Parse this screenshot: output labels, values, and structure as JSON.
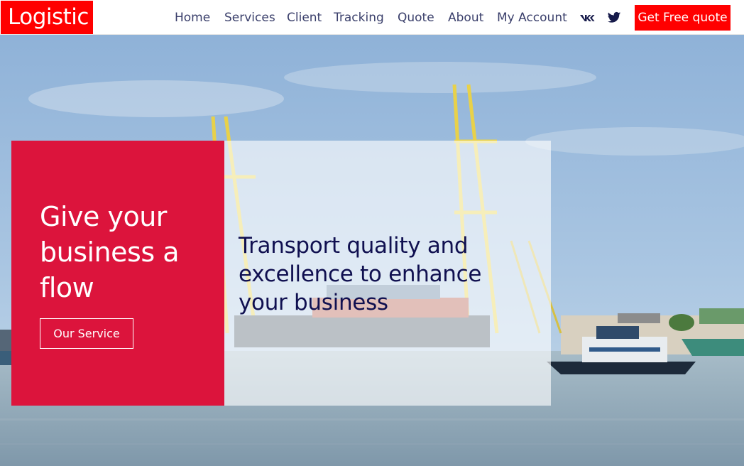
{
  "brand": {
    "logo_text": "Logistic",
    "accent_color": "#ff0000",
    "card_color": "#dc143c",
    "nav_text_color": "#3a3f6b"
  },
  "nav": {
    "items": [
      {
        "label": "Home"
      },
      {
        "label": "Services"
      },
      {
        "label": "Client"
      },
      {
        "label": "Tracking"
      },
      {
        "label": "Quote"
      },
      {
        "label": "About"
      },
      {
        "label": "My Account"
      }
    ],
    "social_icons": [
      "vk-icon",
      "twitter-icon"
    ],
    "cta_label": "Get Free quote"
  },
  "hero": {
    "background": "port-with-cranes-and-ships",
    "red_card": {
      "title": "Give your business a flow",
      "button_label": "Our Service"
    },
    "white_card": {
      "text": "Transport quality and excellence to enhance your business"
    }
  }
}
